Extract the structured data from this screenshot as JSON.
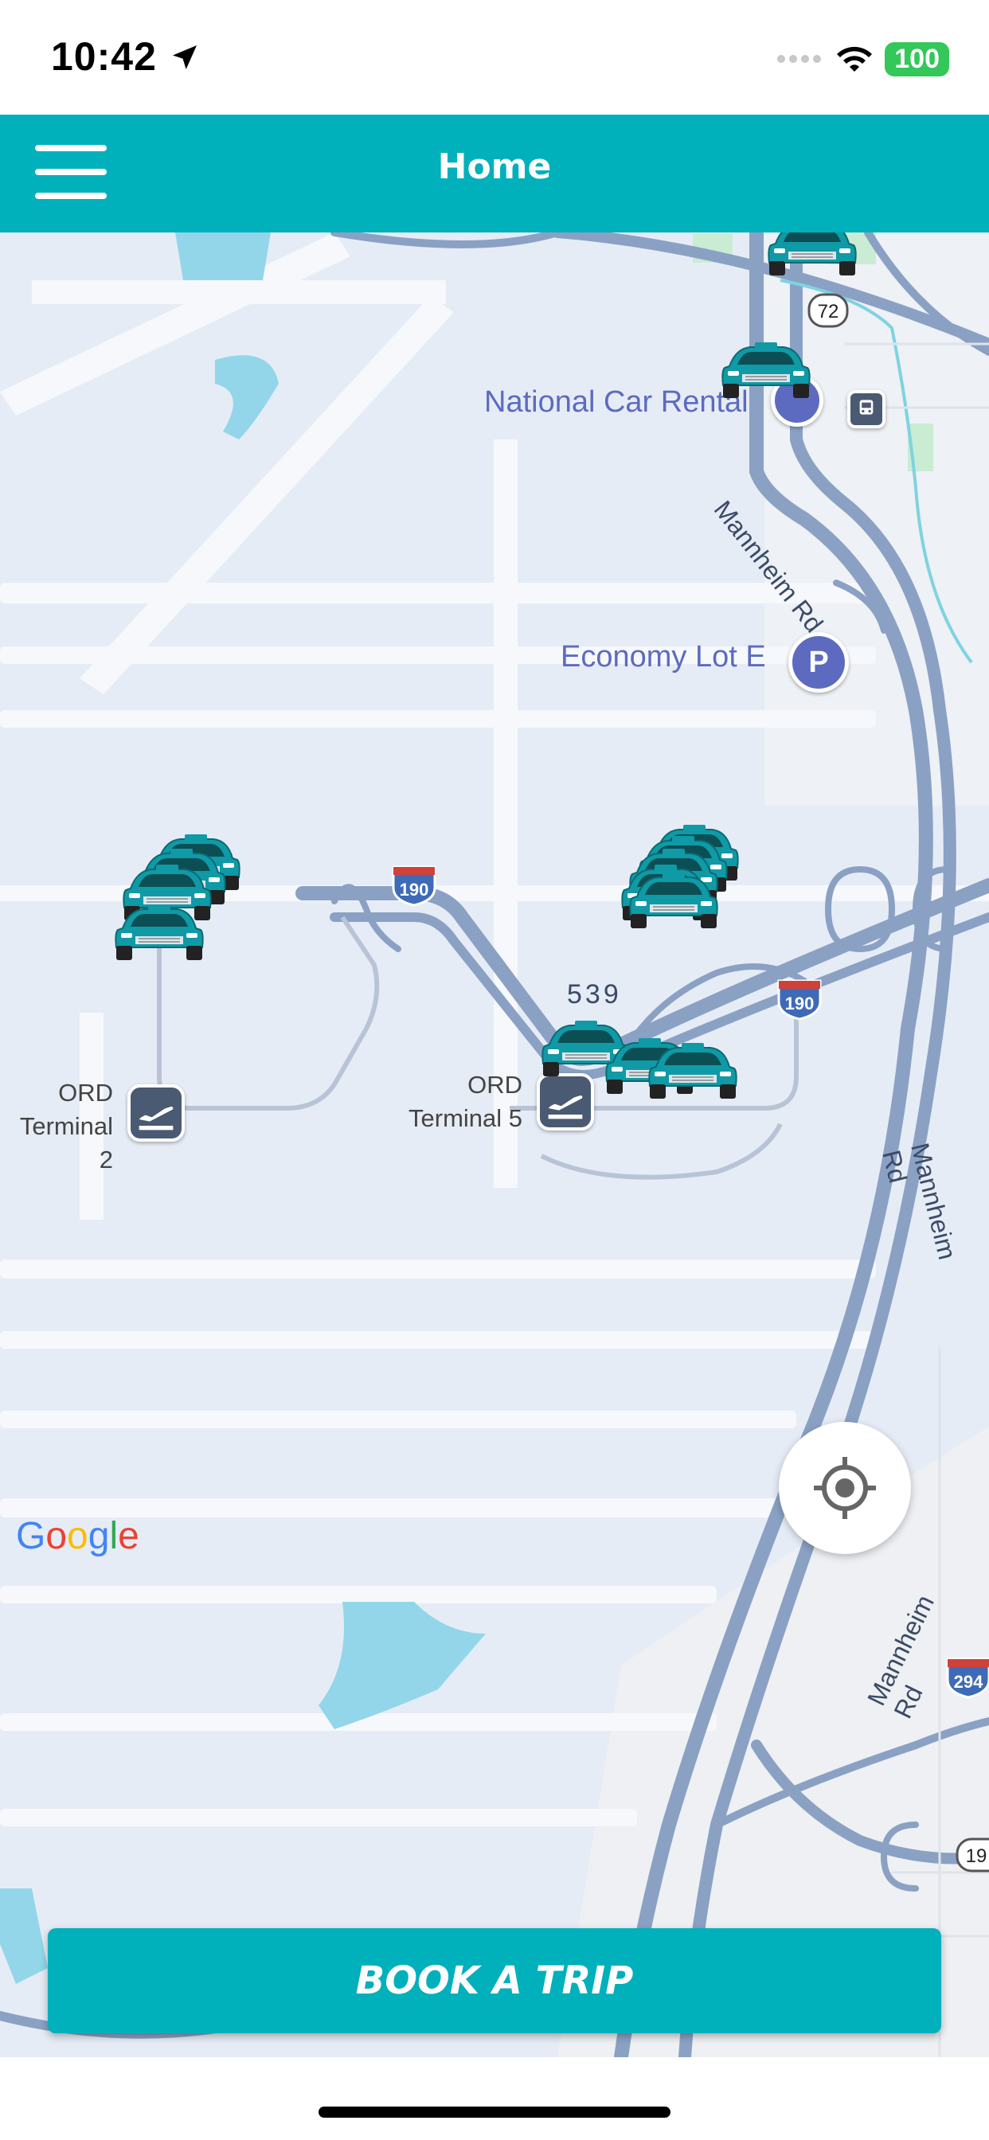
{
  "status_bar": {
    "time": "10:42",
    "battery": "100",
    "icons": [
      "location-arrow-icon",
      "cellular-icon",
      "wifi-icon",
      "battery-icon"
    ]
  },
  "app_bar": {
    "title": "Home",
    "menu_icon": "hamburger-menu-icon",
    "color": "#00b0bb"
  },
  "map": {
    "places": {
      "national_car_rental": "National Car Rental",
      "economy_lot": "Economy Lot E",
      "economy_lot_badge": "P",
      "terminal_2": "ORD\nTerminal 2",
      "terminal_5": "ORD\nTerminal 5"
    },
    "roads": {
      "mannheim_top": "Mannheim Rd",
      "mannheim_mid": "Mannheim Rd",
      "mannheim_bottom": "Mannheim Rd",
      "road_539": "539"
    },
    "shields": {
      "i190_left": "190",
      "i190_right": "190",
      "route_72": "72",
      "i294": "294",
      "route_19": "19"
    },
    "attribution": "Google",
    "locate_icon": "my-location-icon"
  },
  "book_button": {
    "label": "BOOK A TRIP"
  }
}
